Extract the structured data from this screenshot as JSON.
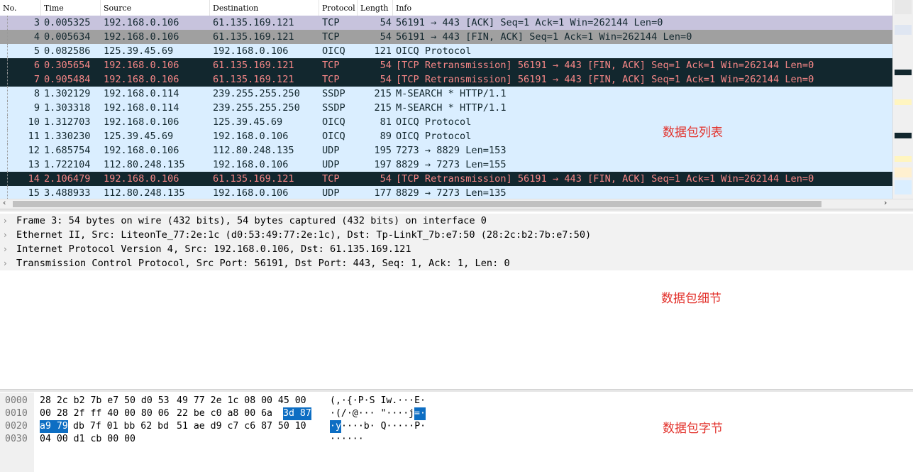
{
  "packet_list": {
    "columns": [
      "No.",
      "Time",
      "Source",
      "Destination",
      "Protocol",
      "Length",
      "Info"
    ],
    "rows": [
      {
        "no": "3",
        "time": "0.005325",
        "src": "192.168.0.106",
        "dst": "61.135.169.121",
        "proto": "TCP",
        "len": "54",
        "info": "56191 → 443 [ACK] Seq=1 Ack=1 Win=262144 Len=0",
        "bg": "#c7c3dd",
        "fg": "#12272e"
      },
      {
        "no": "4",
        "time": "0.005634",
        "src": "192.168.0.106",
        "dst": "61.135.169.121",
        "proto": "TCP",
        "len": "54",
        "info": "56191 → 443 [FIN, ACK] Seq=1 Ack=1 Win=262144 Len=0",
        "bg": "#a0a0a0",
        "fg": "#12272e"
      },
      {
        "no": "5",
        "time": "0.082586",
        "src": "125.39.45.69",
        "dst": "192.168.0.106",
        "proto": "OICQ",
        "len": "121",
        "info": "OICQ Protocol",
        "bg": "#daeeff",
        "fg": "#12272e"
      },
      {
        "no": "6",
        "time": "0.305654",
        "src": "192.168.0.106",
        "dst": "61.135.169.121",
        "proto": "TCP",
        "len": "54",
        "info": "[TCP Retransmission] 56191 → 443 [FIN, ACK] Seq=1 Ack=1 Win=262144 Len=0",
        "bg": "#12272e",
        "fg": "#f78787"
      },
      {
        "no": "7",
        "time": "0.905484",
        "src": "192.168.0.106",
        "dst": "61.135.169.121",
        "proto": "TCP",
        "len": "54",
        "info": "[TCP Retransmission] 56191 → 443 [FIN, ACK] Seq=1 Ack=1 Win=262144 Len=0",
        "bg": "#12272e",
        "fg": "#f78787"
      },
      {
        "no": "8",
        "time": "1.302129",
        "src": "192.168.0.114",
        "dst": "239.255.255.250",
        "proto": "SSDP",
        "len": "215",
        "info": "M-SEARCH * HTTP/1.1",
        "bg": "#daeeff",
        "fg": "#12272e"
      },
      {
        "no": "9",
        "time": "1.303318",
        "src": "192.168.0.114",
        "dst": "239.255.255.250",
        "proto": "SSDP",
        "len": "215",
        "info": "M-SEARCH * HTTP/1.1",
        "bg": "#daeeff",
        "fg": "#12272e"
      },
      {
        "no": "10",
        "time": "1.312703",
        "src": "192.168.0.106",
        "dst": "125.39.45.69",
        "proto": "OICQ",
        "len": "81",
        "info": "OICQ Protocol",
        "bg": "#daeeff",
        "fg": "#12272e"
      },
      {
        "no": "11",
        "time": "1.330230",
        "src": "125.39.45.69",
        "dst": "192.168.0.106",
        "proto": "OICQ",
        "len": "89",
        "info": "OICQ Protocol",
        "bg": "#daeeff",
        "fg": "#12272e"
      },
      {
        "no": "12",
        "time": "1.685754",
        "src": "192.168.0.106",
        "dst": "112.80.248.135",
        "proto": "UDP",
        "len": "195",
        "info": "7273 → 8829 Len=153",
        "bg": "#daeeff",
        "fg": "#12272e"
      },
      {
        "no": "13",
        "time": "1.722104",
        "src": "112.80.248.135",
        "dst": "192.168.0.106",
        "proto": "UDP",
        "len": "197",
        "info": "8829 → 7273 Len=155",
        "bg": "#daeeff",
        "fg": "#12272e"
      },
      {
        "no": "14",
        "time": "2.106479",
        "src": "192.168.0.106",
        "dst": "61.135.169.121",
        "proto": "TCP",
        "len": "54",
        "info": "[TCP Retransmission] 56191 → 443 [FIN, ACK] Seq=1 Ack=1 Win=262144 Len=0",
        "bg": "#12272e",
        "fg": "#f78787"
      },
      {
        "no": "15",
        "time": "3.488933",
        "src": "112.80.248.135",
        "dst": "192.168.0.106",
        "proto": "UDP",
        "len": "177",
        "info": "8829 → 7273 Len=135",
        "bg": "#daeeff",
        "fg": "#12272e"
      }
    ],
    "annotation": "数据包列表"
  },
  "details": {
    "items": [
      "Frame 3: 54 bytes on wire (432 bits), 54 bytes captured (432 bits) on interface 0",
      "Ethernet II, Src: LiteonTe_77:2e:1c (d0:53:49:77:2e:1c), Dst: Tp-LinkT_7b:e7:50 (28:2c:b2:7b:e7:50)",
      "Internet Protocol Version 4, Src: 192.168.0.106, Dst: 61.135.169.121",
      "Transmission Control Protocol, Src Port: 56191, Dst Port: 443, Seq: 1, Ack: 1, Len: 0"
    ],
    "annotation": "数据包细节"
  },
  "bytes": {
    "rows": [
      {
        "offset": "0000",
        "hex1": "28 2c b2 7b e7 50 d0 53",
        "hex2": "49 77 2e 1c 08 00 45 00",
        "ascii": "(,·{·P·S Iw.···E·"
      },
      {
        "offset": "0010",
        "hex1": "00 28 2f ff 40 00 80 06",
        "hex2": "22 be c0 a8 00 6a",
        "hex_sel": "3d 87",
        "ascii": "·(/·@··· \"····j",
        "ascii_sel": "=·"
      },
      {
        "offset": "0020",
        "hex_sel": "a9 79",
        "hex1": "db 7f 01 bb 62 bd",
        "hex2": "51 ae d9 c7 c6 87 50 10",
        "ascii_sel": "·y",
        "ascii": "····b· Q·····P·"
      },
      {
        "offset": "0030",
        "hex1": "04 00 d1 cb 00 00",
        "hex2": "",
        "ascii": "······"
      }
    ],
    "annotation": "数据包字节"
  },
  "colors": {
    "selected": "#0d6ec3",
    "tcp_bad_bg": "#12272e",
    "tcp_bad_fg": "#f78787",
    "udp_bg": "#daeeff"
  },
  "icons": {
    "expand": "chevron-right-icon",
    "scroll_left": "arrow-left-icon",
    "scroll_right": "arrow-right-icon"
  }
}
